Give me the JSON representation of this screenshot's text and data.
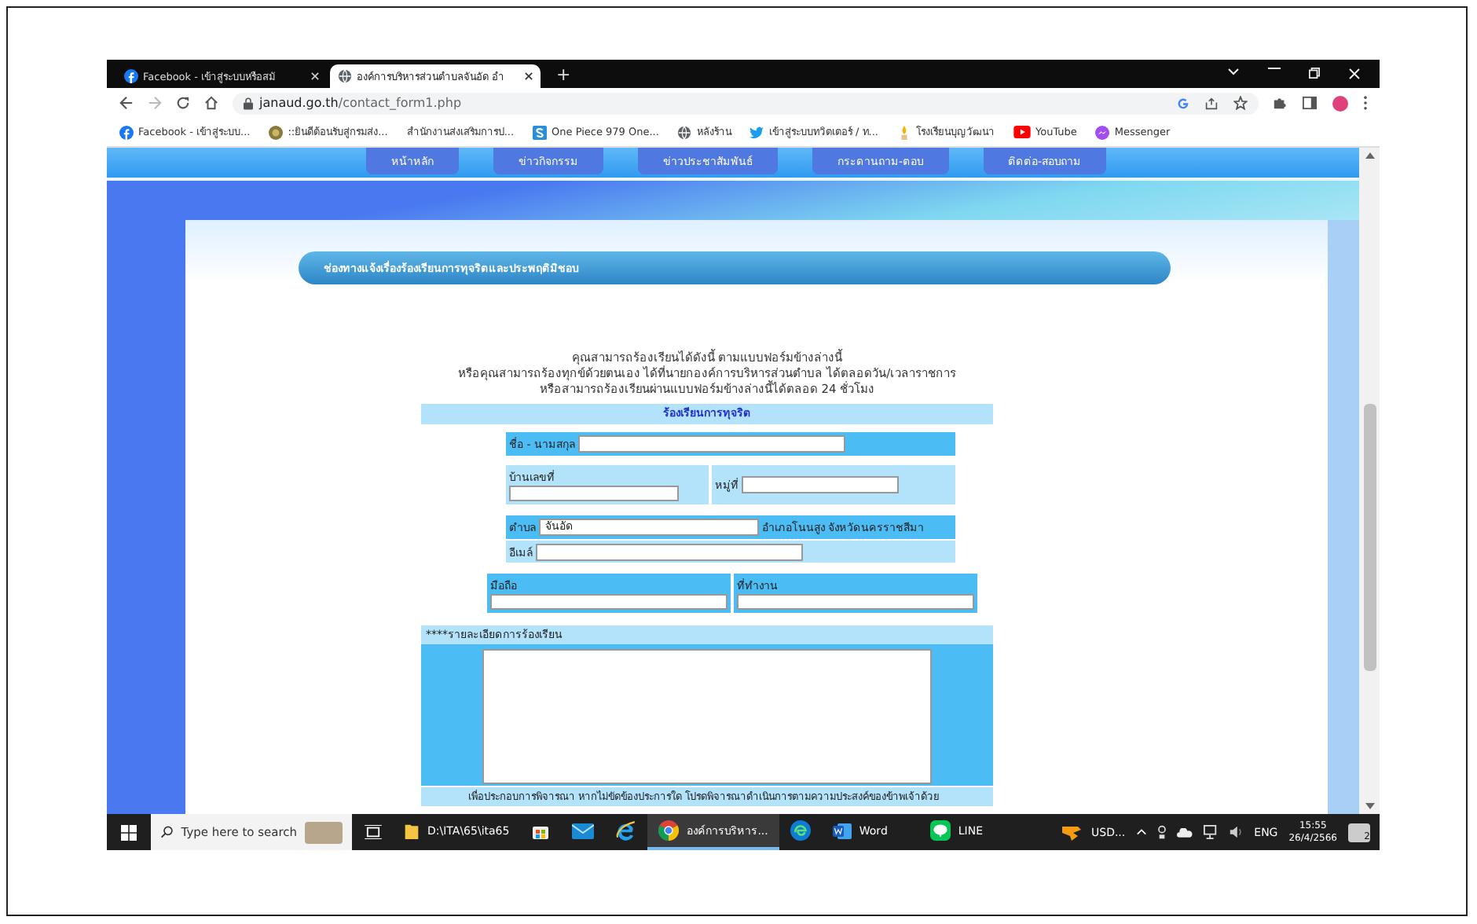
{
  "browser": {
    "tabs": [
      {
        "title": "Facebook - เข้าสู่ระบบหรือสมั",
        "kind": "facebook",
        "selected": false
      },
      {
        "title": "องค์การบริหารส่วนตำบลจันอัด อำ",
        "kind": "globe",
        "selected": true
      }
    ],
    "new_tab": "+",
    "url_host": "janaud.go.th",
    "url_path": "/contact_form1.php",
    "bookmarks": [
      {
        "label": "Facebook - เข้าสู่ระบบ...",
        "kind": "facebook"
      },
      {
        "label": "::ยินดีต้อนรับสู่กรมส่ง...",
        "kind": "emblem"
      },
      {
        "label": "สำนักงานส่งเสริมการป...",
        "kind": "blank"
      },
      {
        "label": "One Piece 979 One...",
        "kind": "s"
      },
      {
        "label": "หลังร้าน",
        "kind": "globe"
      },
      {
        "label": "เข้าสู่ระบบทวิตเตอร์ / ท...",
        "kind": "twitter"
      },
      {
        "label": "โรงเรียนบุญวัฒนา",
        "kind": "candle"
      },
      {
        "label": "YouTube",
        "kind": "youtube"
      },
      {
        "label": "Messenger",
        "kind": "messenger"
      }
    ]
  },
  "page": {
    "nav": [
      "หน้าหลัก",
      "ข่าวกิจกรรม",
      "ข่าวประชาสัมพันธ์",
      "กระดานถาม-ตอบ",
      "ติดต่อ-สอบถาม"
    ],
    "title": "ช่องทางแจ้งเรื่องร้องเรียนการทุจริตและประพฤติมิชอบ",
    "intro": [
      "คุณสามารถร้องเรียนได้ดังนี้ ตามแบบฟอร์มข้างล่างนี้",
      "หรือคุณสามารถร้องทุกข์ด้วยตนเอง ได้ที่นายกองค์การบริหารส่วนตำบล ได้ตลอดวัน/เวลาราชการ",
      "หรือสามารถร้องเรียนผ่านแบบฟอร์มข้างล่างนี้ได้ตลอด 24 ชั่วโมง"
    ],
    "form": {
      "header": "ร้องเรียนการทุจริต",
      "name_label": "ชื่อ - นามสกุล",
      "house_label": "บ้านเลขที่",
      "moo_label": "หมู่ที่",
      "tambon_label": "ตำบล",
      "tambon_value": "จันอัด",
      "district_text": "อำเภอโนนสูง จังหวัดนครราชสีมา",
      "email_label": "อีเมล์",
      "mobile_label": "มือถือ",
      "work_label": "ที่ทำงาน",
      "detail_label": "****รายละเอียดการร้องเรียน",
      "footer": "เพื่อประกอบการพิจารณา หากไม่ขัดข้องประการใด โปรดพิจารณาดำเนินการตามความประสงค์ของข้าพเจ้าด้วย"
    }
  },
  "taskbar": {
    "search_placeholder": "Type here to search",
    "items": [
      {
        "kind": "folder",
        "label": "D:\\ITA\\65\\ita65",
        "selected": false
      },
      {
        "kind": "store",
        "selected": false
      },
      {
        "kind": "mail",
        "selected": false
      },
      {
        "kind": "ie",
        "selected": false
      },
      {
        "kind": "chrome",
        "label": "องค์การบริหาร...",
        "selected": true
      },
      {
        "kind": "edge",
        "selected": false
      },
      {
        "kind": "word",
        "label": "Word",
        "selected": false
      },
      {
        "kind": "line",
        "label": "LINE",
        "selected": false
      }
    ],
    "widget": "USD...",
    "lang": "ENG",
    "time": "15:55",
    "date": "26/4/2566",
    "notifications": "2"
  }
}
